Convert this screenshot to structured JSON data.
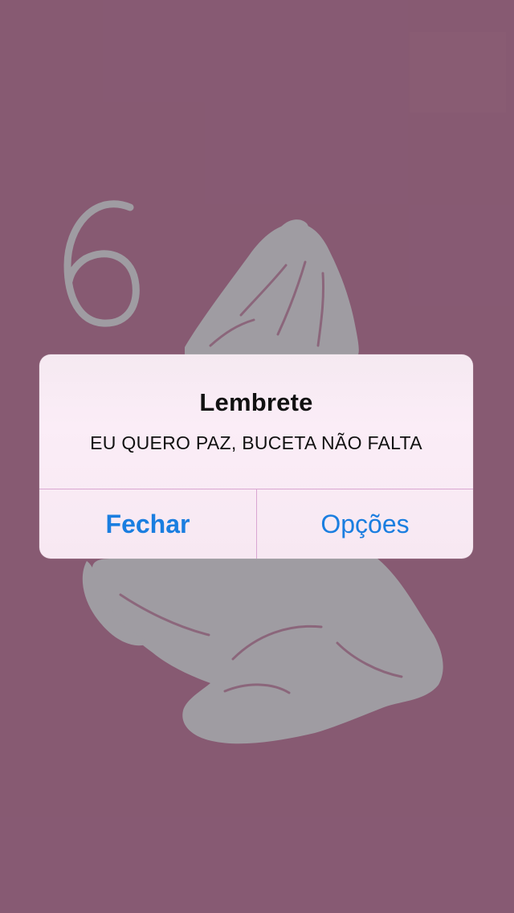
{
  "wallpaper": {
    "number": "6",
    "background_color": "#8a5c75",
    "art_color": "#a3a0a6",
    "art_icon": "praying-hands-icon"
  },
  "alert": {
    "title": "Lembrete",
    "message": "EU QUERO PAZ, BUCETA NÃO FALTA",
    "buttons": {
      "close_label": "Fechar",
      "options_label": "Opções"
    },
    "accent_color": "#1a7ee0",
    "divider_color": "#d9a6d2"
  }
}
